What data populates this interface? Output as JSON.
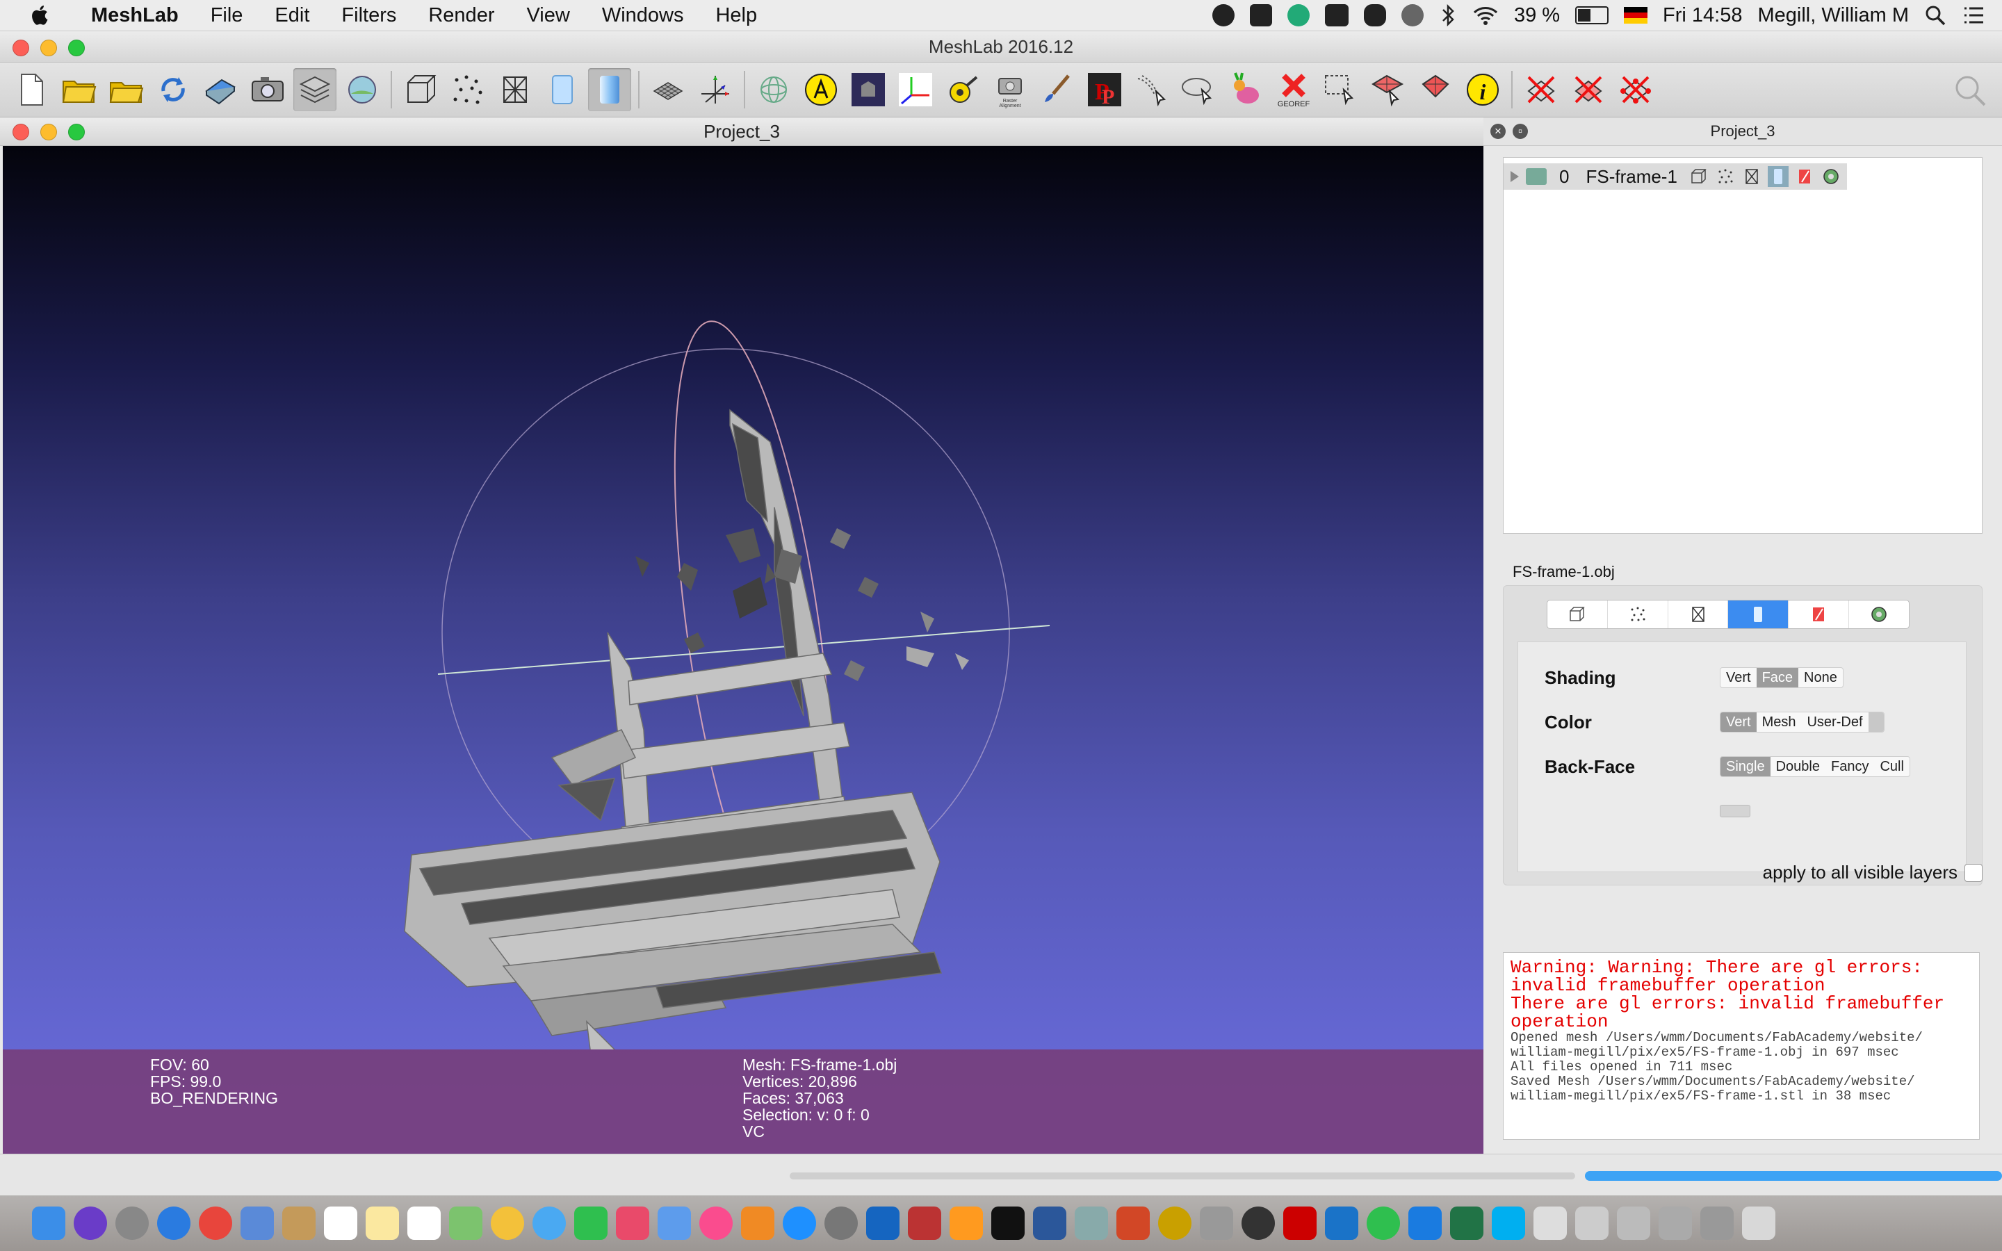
{
  "menubar": {
    "app_name": "MeshLab",
    "menus": [
      "File",
      "Edit",
      "Filters",
      "Render",
      "View",
      "Windows",
      "Help"
    ],
    "battery": "39 %",
    "clock": "Fri 14:58",
    "user": "Megill, William M"
  },
  "window": {
    "title": "MeshLab 2016.12"
  },
  "project": {
    "title": "Project_3"
  },
  "viewport": {
    "hud_left": [
      "FOV: 60",
      "FPS:  99.0",
      "BO_RENDERING"
    ],
    "hud_center": [
      "Mesh: FS-frame-1.obj",
      "Vertices: 20,896",
      "Faces: 37,063",
      "Selection: v: 0 f: 0",
      "VC"
    ]
  },
  "layers": {
    "panel_title": "Project_3",
    "items": [
      {
        "index": "0",
        "name": "FS-frame-1"
      }
    ]
  },
  "render_panel": {
    "mesh_file": "FS-frame-1.obj",
    "shading": {
      "label": "Shading",
      "options": [
        "Vert",
        "Face",
        "None"
      ],
      "selected": "Face"
    },
    "color": {
      "label": "Color",
      "options": [
        "Vert",
        "Mesh",
        "User-Def"
      ],
      "selected": "Vert"
    },
    "backface": {
      "label": "Back-Face",
      "options": [
        "Single",
        "Double",
        "Fancy",
        "Cull"
      ],
      "selected": "Single"
    },
    "apply_all": "apply to all visible layers"
  },
  "log": {
    "warnings": [
      "Warning: Warning: There are gl errors:",
      "invalid framebuffer operation",
      "There are gl errors: invalid framebuffer",
      "operation"
    ],
    "info": [
      "Opened mesh /Users/wmm/Documents/FabAcademy/website/",
      "william-megill/pix/ex5/FS-frame-1.obj in 697 msec",
      "All files opened in 711 msec",
      "Saved Mesh /Users/wmm/Documents/FabAcademy/website/",
      "william-megill/pix/ex5/FS-frame-1.stl in 38 msec"
    ]
  },
  "colors": {
    "warning_text": "#e40000",
    "selected_tab": "#3c8cf0",
    "progress": "#3da3f5",
    "info_band": "#783c78"
  }
}
